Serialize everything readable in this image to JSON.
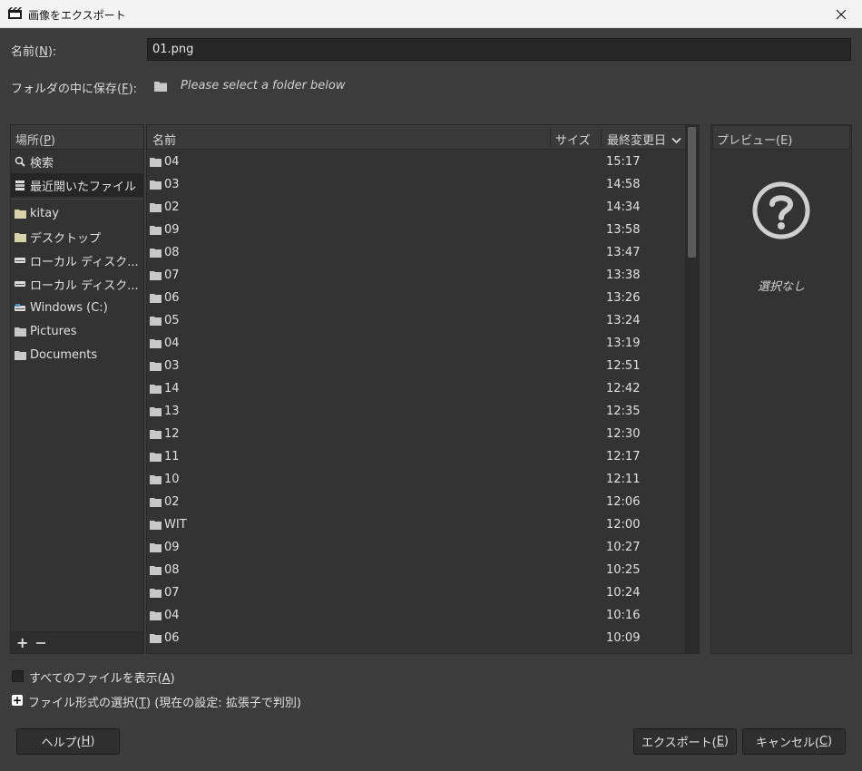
{
  "window": {
    "title": "画像をエクスポート",
    "icon": "gimp-export-icon",
    "close_icon": "close-icon"
  },
  "name_row": {
    "label_prefix": "名前(",
    "label_key": "N",
    "label_suffix": "):",
    "value": "01.png"
  },
  "folder_row": {
    "label_prefix": "フォルダの中に保存(",
    "label_key": "F",
    "label_suffix": "):",
    "placeholder": "Please select a folder below"
  },
  "places": {
    "header_prefix": "場所(",
    "header_key": "P",
    "header_suffix": ")",
    "items": [
      {
        "label": "検索",
        "icon": "search-icon"
      },
      {
        "label": "最近開いたファイル",
        "icon": "recent-icon",
        "selected": true
      },
      {
        "label": "kitay",
        "icon": "home-folder-icon"
      },
      {
        "label": "デスクトップ",
        "icon": "desktop-folder-icon"
      },
      {
        "label": "ローカル ディスク...",
        "icon": "drive-icon"
      },
      {
        "label": "ローカル ディスク...",
        "icon": "drive-icon"
      },
      {
        "label": "Windows (C:)",
        "icon": "windows-drive-icon"
      },
      {
        "label": "Pictures",
        "icon": "folder-icon"
      },
      {
        "label": "Documents",
        "icon": "folder-icon"
      }
    ],
    "add_label": "+",
    "remove_icon": "minus-icon"
  },
  "files": {
    "columns": {
      "name": "名前",
      "size": "サイズ",
      "modified": "最終変更日"
    },
    "sort_icon": "chevron-down-icon",
    "rows": [
      {
        "name": "04",
        "time": "15:17"
      },
      {
        "name": "03",
        "time": "14:58"
      },
      {
        "name": "02",
        "time": "14:34"
      },
      {
        "name": "09",
        "time": "13:58"
      },
      {
        "name": "08",
        "time": "13:47"
      },
      {
        "name": "07",
        "time": "13:38"
      },
      {
        "name": "06",
        "time": "13:26"
      },
      {
        "name": "05",
        "time": "13:24"
      },
      {
        "name": "04",
        "time": "13:19"
      },
      {
        "name": "03",
        "time": "12:51"
      },
      {
        "name": "14",
        "time": "12:42"
      },
      {
        "name": "13",
        "time": "12:35"
      },
      {
        "name": "12",
        "time": "12:30"
      },
      {
        "name": "11",
        "time": "12:17"
      },
      {
        "name": "10",
        "time": "12:11"
      },
      {
        "name": "02",
        "time": "12:06"
      },
      {
        "name": "WIT",
        "time": "12:00"
      },
      {
        "name": "09",
        "time": "10:27"
      },
      {
        "name": "08",
        "time": "10:25"
      },
      {
        "name": "07",
        "time": "10:24"
      },
      {
        "name": "04",
        "time": "10:16"
      },
      {
        "name": "06",
        "time": "10:09"
      }
    ]
  },
  "preview": {
    "header_prefix": "プレビュー(",
    "header_key": "E",
    "header_suffix": ")",
    "icon": "question-icon",
    "empty_text": "選択なし"
  },
  "options": {
    "show_all_prefix": "すべてのファイルを表示(",
    "show_all_key": "A",
    "show_all_suffix": ")",
    "filetype_prefix": "ファイル形式の選択(",
    "filetype_key": "T",
    "filetype_suffix": ") (現在の設定: 拡張子で判別)",
    "expander_label": "+"
  },
  "buttons": {
    "help_prefix": "ヘルプ(",
    "help_key": "H",
    "help_suffix": ")",
    "export_prefix": "エクスポート(",
    "export_key": "E",
    "export_suffix": ")",
    "cancel_prefix": "キャンセル(",
    "cancel_key": "C",
    "cancel_suffix": ")"
  },
  "colors": {
    "dialog_bg": "#3c3c3c",
    "panel_bg": "#333333",
    "folder_icon": "#c8c8c8"
  }
}
